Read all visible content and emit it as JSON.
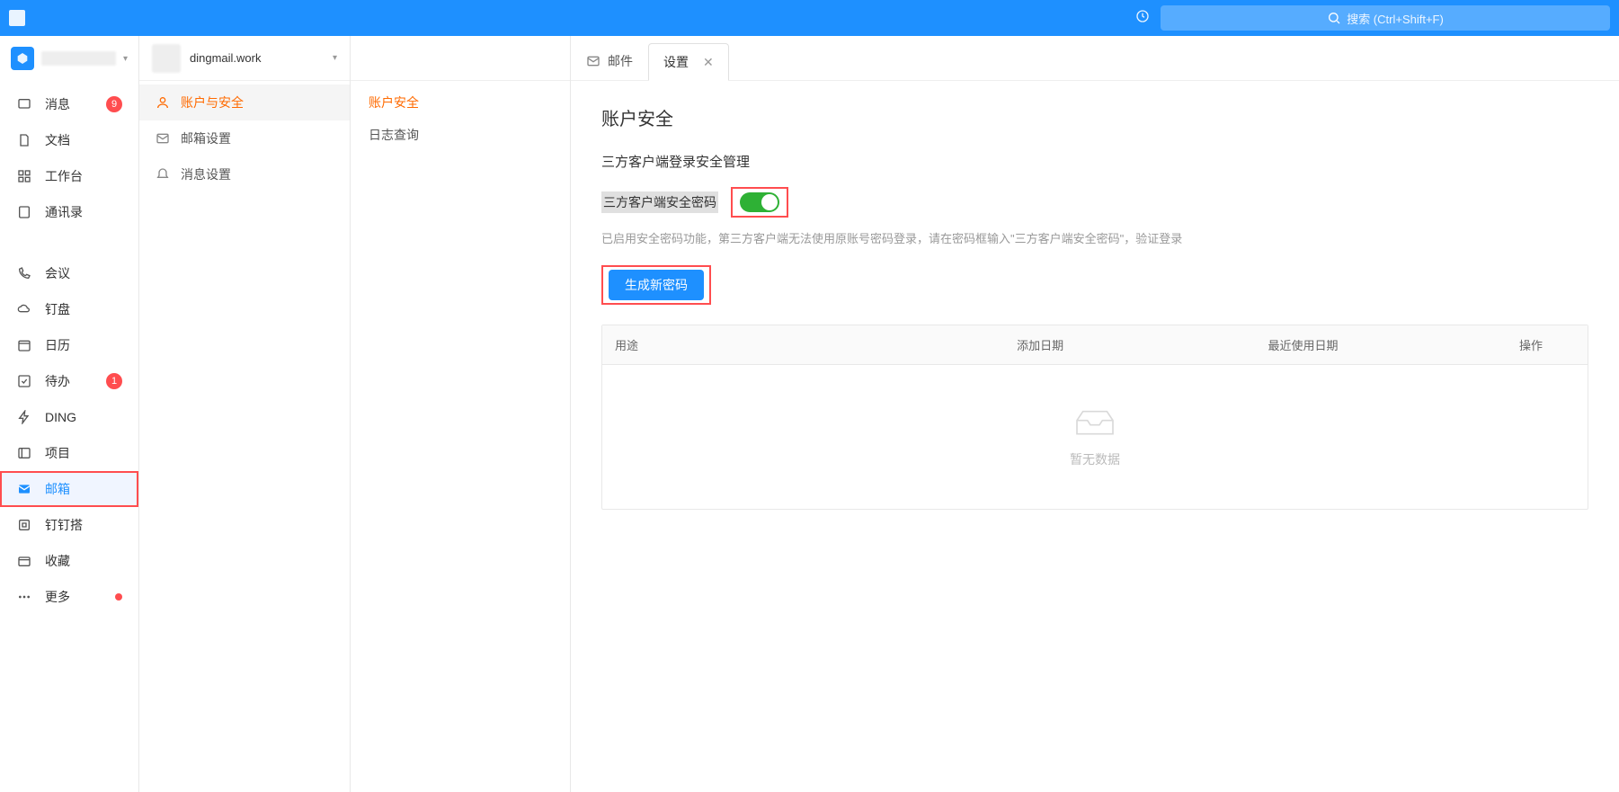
{
  "topbar": {
    "search_placeholder": "搜索 (Ctrl+Shift+F)"
  },
  "sidebar": {
    "items": [
      {
        "label": "消息",
        "badge": "9"
      },
      {
        "label": "文档"
      },
      {
        "label": "工作台"
      },
      {
        "label": "通讯录"
      },
      {
        "gap": true
      },
      {
        "label": "会议"
      },
      {
        "label": "钉盘"
      },
      {
        "label": "日历"
      },
      {
        "label": "待办",
        "badge": "1"
      },
      {
        "label": "DING"
      },
      {
        "label": "项目"
      },
      {
        "label": "邮箱",
        "active": true
      },
      {
        "label": "钉钉搭"
      },
      {
        "label": "收藏"
      },
      {
        "label": "更多",
        "dot": true
      }
    ]
  },
  "account": {
    "email": "dingmail.work",
    "settings_groups": [
      {
        "label": "账户与安全",
        "active": true
      },
      {
        "label": "邮箱设置"
      },
      {
        "label": "消息设置"
      }
    ],
    "sub_items": [
      {
        "label": "账户安全",
        "active": true
      },
      {
        "label": "日志查询"
      }
    ]
  },
  "tabs": {
    "mail_tab": "邮件",
    "settings_tab": "设置"
  },
  "content": {
    "page_title": "账户安全",
    "section_title": "三方客户端登录安全管理",
    "toggle_label": "三方客户端安全密码",
    "toggle_on": true,
    "hint_text": "已启用安全密码功能，第三方客户端无法使用原账号密码登录，请在密码框输入\"三方客户端安全密码\"，验证登录",
    "generate_button": "生成新密码",
    "table": {
      "columns": [
        "用途",
        "添加日期",
        "最近使用日期",
        "操作"
      ],
      "empty_text": "暂无数据"
    }
  }
}
